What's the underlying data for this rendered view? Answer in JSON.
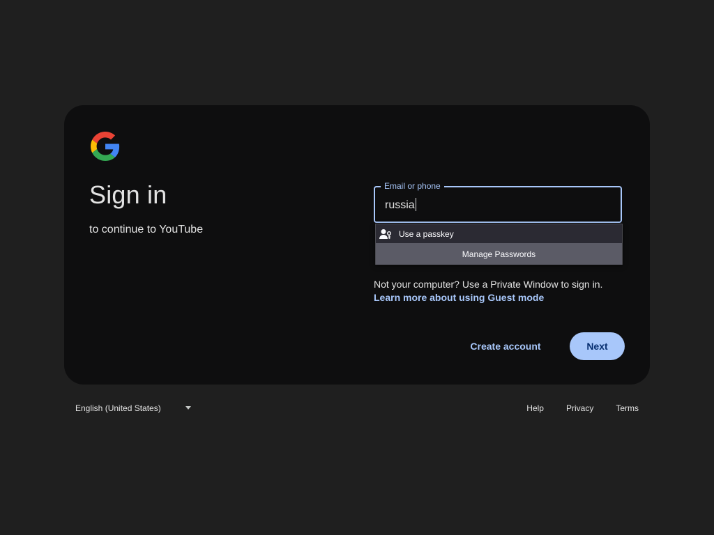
{
  "signin": {
    "title": "Sign in",
    "subtitle": "to continue to YouTube"
  },
  "email_field": {
    "label": "Email or phone",
    "value": "russia"
  },
  "autofill": {
    "passkey_label": "Use a passkey",
    "manage_label": "Manage Passwords"
  },
  "guest_note": {
    "text": "Not your computer? Use a Private Window to sign in.",
    "link": "Learn more about using Guest mode"
  },
  "actions": {
    "create_account": "Create account",
    "next": "Next"
  },
  "footer": {
    "language": "English (United States)",
    "help": "Help",
    "privacy": "Privacy",
    "terms": "Terms"
  },
  "colors": {
    "background": "#1f1f1f",
    "card": "#0e0e0f",
    "accent": "#a8c7fa",
    "next_text": "#062e6f",
    "autofill_bg": "#2b2a33",
    "autofill_selected": "#5b5b66"
  }
}
